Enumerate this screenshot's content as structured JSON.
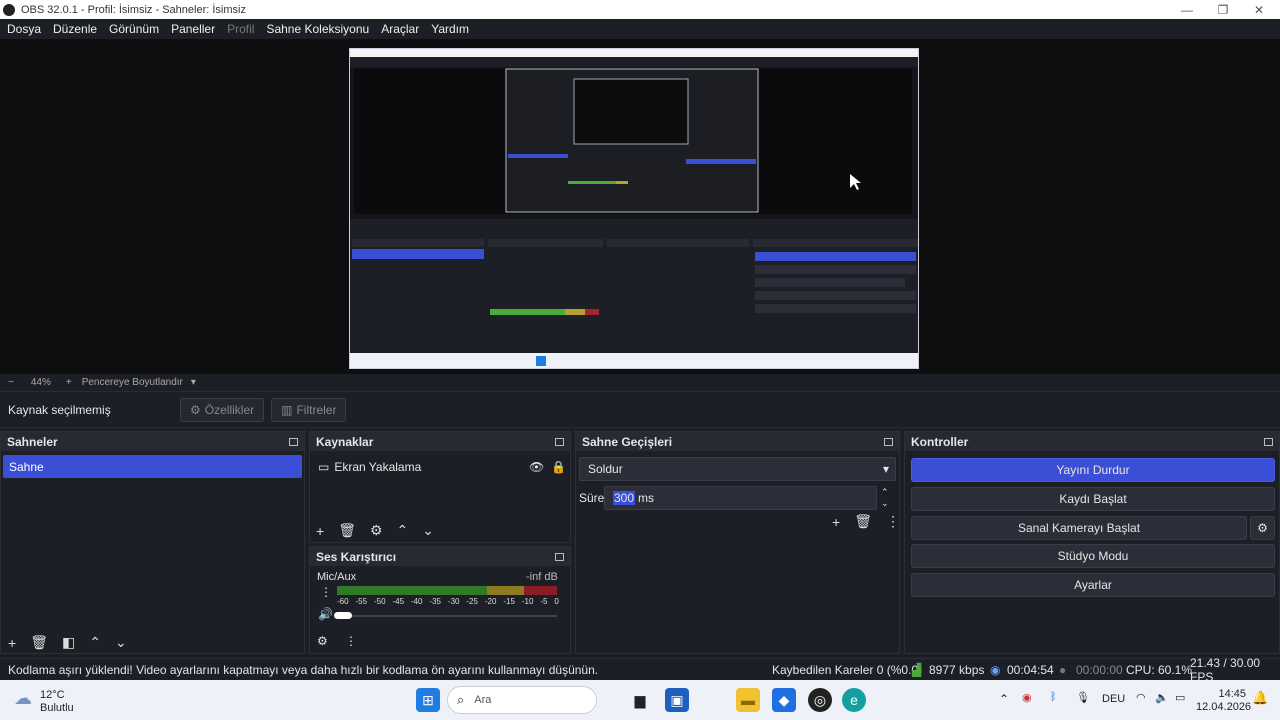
{
  "window": {
    "title": "OBS 32.0.1 - Profil: İsimsiz - Sahneler: İsimsiz",
    "minimize": "—",
    "maximize": "❐",
    "close": "✕"
  },
  "menu": [
    "Dosya",
    "Düzenle",
    "Görünüm",
    "Paneller",
    "Profil",
    "Sahne Koleksiyonu",
    "Araçlar",
    "Yardım"
  ],
  "zoom": {
    "minus": "−",
    "level": "44%",
    "plus": "+",
    "fit_label": "Pencereye Boyutlandır"
  },
  "source_bar": {
    "no_source": "Kaynak seçilmemiş",
    "properties": "Özellikler",
    "filters": "Filtreler"
  },
  "scenes": {
    "title": "Sahneler",
    "items": [
      "Sahne"
    ]
  },
  "sources": {
    "title": "Kaynaklar",
    "items": [
      "Ekran Yakalama"
    ]
  },
  "mixer": {
    "title": "Ses Karıştırıcı",
    "channel": "Mic/Aux",
    "level": "-inf dB",
    "ticks": [
      "-60",
      "-55",
      "-50",
      "-45",
      "-40",
      "-35",
      "-30",
      "-25",
      "-20",
      "-15",
      "-10",
      "-5",
      "0"
    ]
  },
  "transitions": {
    "title": "Sahne Geçişleri",
    "selected": "Soldur",
    "duration_label": "Süre",
    "duration_value": "300",
    "duration_unit": "ms"
  },
  "controls": {
    "title": "Kontroller",
    "stop_stream": "Yayını Durdur",
    "start_record": "Kaydı Başlat",
    "virtual_cam": "Sanal Kamerayı Başlat",
    "studio": "Stüdyo Modu",
    "settings": "Ayarlar"
  },
  "status": {
    "warning": "Kodlama aşırı yüklendi! Video ayarlarını kapatmayı veya daha hızlı bir kodlama ön ayarını kullanmayı düşünün.",
    "dropped": "Kaybedilen Kareler 0 (%0.0)",
    "bitrate": "8977 kbps",
    "stream_time": "00:04:54",
    "rec_time": "00:00:00",
    "cpu": "CPU: 60.1%",
    "fps": "21.43 / 30.00 FPS"
  },
  "taskbar": {
    "temp": "12°C",
    "weather": "Bulutlu",
    "search": "Ara",
    "lang": "DEU",
    "time": "14:45",
    "date": "12.04.2026"
  },
  "colors": {
    "accent": "#3a4ed6",
    "bg": "#1d1f26"
  }
}
